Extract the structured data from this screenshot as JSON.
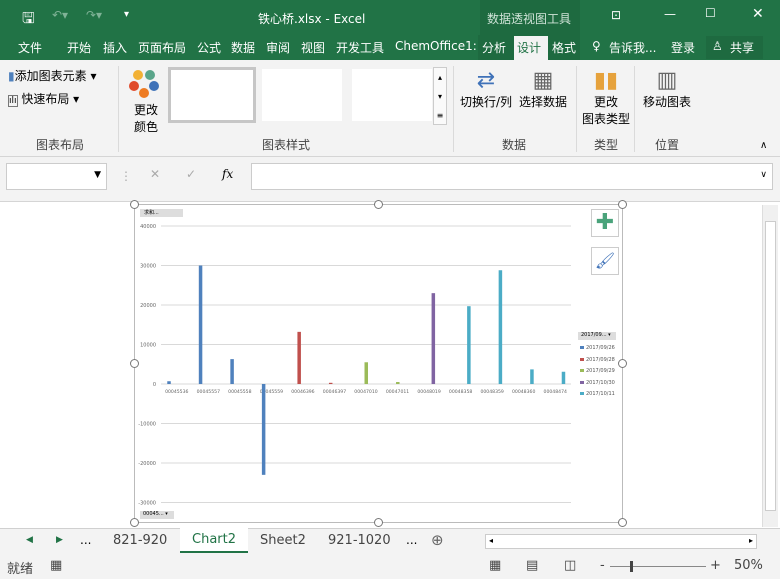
{
  "titlebar": {
    "title": "铁心桥.xlsx - Excel",
    "context_tab": "数据透视图工具"
  },
  "tabs": [
    "文件",
    "开始",
    "插入",
    "页面布局",
    "公式",
    "数据",
    "审阅",
    "视图",
    "开发工具",
    "ChemOffice1:",
    "分析",
    "设计",
    "格式"
  ],
  "tell_me": "告诉我...",
  "login": "登录",
  "share": "共享",
  "ribbon": {
    "add_element": "添加图表元素",
    "quick_layout": "快速布局",
    "change_color_1": "更改",
    "change_color_2": "颜色",
    "group_layout": "图表布局",
    "group_styles": "图表样式",
    "switch_rowcol": "切换行/列",
    "select_data": "选择数据",
    "group_data": "数据",
    "change_type_1": "更改",
    "change_type_2": "图表类型",
    "group_type": "类型",
    "move_chart": "移动图表",
    "group_location": "位置"
  },
  "formula_bar": {
    "name_box": "",
    "fx": "fx",
    "formula": ""
  },
  "colors": {
    "accent": "#217346",
    "s1": "#4f81bd",
    "s2": "#c0504d",
    "s3": "#9bbb59",
    "s4": "#8064a2",
    "s5": "#4bacc6"
  },
  "chart_data": {
    "type": "bar",
    "value_field_button": "求和...",
    "row_field_button": "00045...",
    "legend_field_button": "2017/09...",
    "categories": [
      "00045536",
      "00045557",
      "00045558",
      "00045559",
      "00046396",
      "00046397",
      "00047010",
      "00047011",
      "00048019",
      "00048358",
      "00048359",
      "00048360",
      "00048474"
    ],
    "series": [
      {
        "name": "2017/09/26",
        "values": [
          700,
          30000,
          6300,
          -23000,
          null,
          null,
          null,
          null,
          null,
          null,
          null,
          null,
          null
        ]
      },
      {
        "name": "2017/09/28",
        "values": [
          null,
          null,
          null,
          null,
          13200,
          300,
          null,
          null,
          null,
          null,
          null,
          null,
          null
        ]
      },
      {
        "name": "2017/09/29",
        "values": [
          null,
          null,
          null,
          null,
          null,
          null,
          5500,
          500,
          null,
          null,
          null,
          null,
          null
        ]
      },
      {
        "name": "2017/10/30",
        "values": [
          null,
          null,
          null,
          null,
          null,
          null,
          null,
          null,
          23000,
          null,
          null,
          null,
          null
        ]
      },
      {
        "name": "2017/10/11",
        "values": [
          null,
          null,
          null,
          null,
          null,
          null,
          null,
          null,
          null,
          19700,
          28800,
          3700,
          3100
        ]
      }
    ],
    "yticks": [
      40000,
      30000,
      20000,
      10000,
      0,
      -10000,
      -20000,
      -30000
    ],
    "ylim": [
      -30000,
      40000
    ],
    "grid": true,
    "legend_position": "right"
  },
  "sheet_tabs": {
    "items": [
      "821-920",
      "Chart2",
      "Sheet2",
      "921-1020"
    ],
    "ellipsis": "...",
    "active": "Chart2"
  },
  "status": {
    "ready": "就绪",
    "zoom": "50%"
  }
}
